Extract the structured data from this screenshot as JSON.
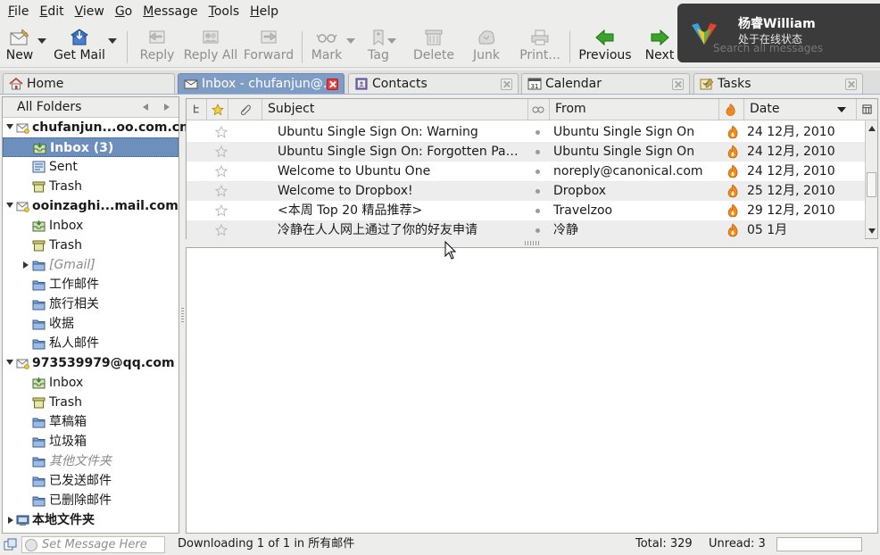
{
  "menu": [
    "File",
    "Edit",
    "View",
    "Go",
    "Message",
    "Tools",
    "Help"
  ],
  "menu_mnemonics": [
    "F",
    "E",
    "V",
    "G",
    "M",
    "T",
    "H"
  ],
  "toolbar": {
    "new": "New",
    "get_mail": "Get Mail",
    "reply": "Reply",
    "reply_all": "Reply All",
    "forward": "Forward",
    "mark": "Mark",
    "tag": "Tag",
    "delete": "Delete",
    "junk": "Junk",
    "print": "Print...",
    "previous": "Previous",
    "next": "Next"
  },
  "notification": {
    "name": "杨睿William",
    "status": "处于在线状态",
    "behind_text": "Search all messages"
  },
  "tabs": [
    {
      "label": "Home",
      "icon": "home-icon",
      "active": false
    },
    {
      "label": "Inbox - chufanjun@...",
      "icon": "mail-icon",
      "active": true
    },
    {
      "label": "Contacts",
      "icon": "address-book-icon",
      "active": false
    },
    {
      "label": "Calendar",
      "icon": "calendar-icon",
      "active": false
    },
    {
      "label": "Tasks",
      "icon": "tasks-icon",
      "active": false
    }
  ],
  "folder_pane": {
    "header": "All Folders",
    "accounts": [
      {
        "name": "chufanjun...oo.com.cn",
        "folders": [
          {
            "label": "Inbox (3)",
            "selected": true,
            "bold": true
          },
          {
            "label": "Sent"
          },
          {
            "label": "Trash"
          }
        ]
      },
      {
        "name": "ooinzaghi...mail.com",
        "folders": [
          {
            "label": "Inbox"
          },
          {
            "label": "Trash"
          },
          {
            "label": "[Gmail]",
            "italic": true,
            "collapsed": true
          },
          {
            "label": "工作邮件"
          },
          {
            "label": "旅行相关"
          },
          {
            "label": "收据"
          },
          {
            "label": "私人邮件"
          }
        ]
      },
      {
        "name": "973539979@qq.com",
        "folders": [
          {
            "label": "Inbox"
          },
          {
            "label": "Trash"
          },
          {
            "label": "草稿箱"
          },
          {
            "label": "垃圾箱"
          },
          {
            "label": "其他文件夹",
            "italic": true
          },
          {
            "label": "已发送邮件"
          },
          {
            "label": "已删除邮件"
          }
        ]
      },
      {
        "name": "本地文件夹",
        "collapsed": true
      }
    ]
  },
  "thread_pane": {
    "columns": {
      "subject": "Subject",
      "from": "From",
      "date": "Date"
    },
    "messages": [
      {
        "subject": "Ubuntu Single Sign On: Warning",
        "from": "Ubuntu Single Sign On",
        "date": "24 12月, 2010"
      },
      {
        "subject": "Ubuntu Single Sign On: Forgotten Passw...",
        "from": "Ubuntu Single Sign On",
        "date": "24 12月, 2010"
      },
      {
        "subject": "Welcome to Ubuntu One",
        "from": "noreply@canonical.com",
        "date": "24 12月, 2010"
      },
      {
        "subject": "Welcome to Dropbox!",
        "from": "Dropbox",
        "date": "25 12月, 2010"
      },
      {
        "subject": "<本周 Top 20 精品推荐>",
        "from": "Travelzoo",
        "date": "29 12月, 2010"
      },
      {
        "subject": "冷静在人人网上通过了你的好友申请",
        "from": "冷静",
        "date": "05  1月"
      }
    ]
  },
  "status_bar": {
    "message_placeholder": "Set Message Here",
    "status": "Downloading 1 of 1 in 所有邮件",
    "total": "Total: 329",
    "unread": "Unread: 3"
  },
  "colors": {
    "selection": "#6d8fbd",
    "active_tab": "#7f9dc4",
    "arrow_green": "#3aa52a",
    "flame": "#f08a1c",
    "notification_bg": "#3b3b3b"
  }
}
